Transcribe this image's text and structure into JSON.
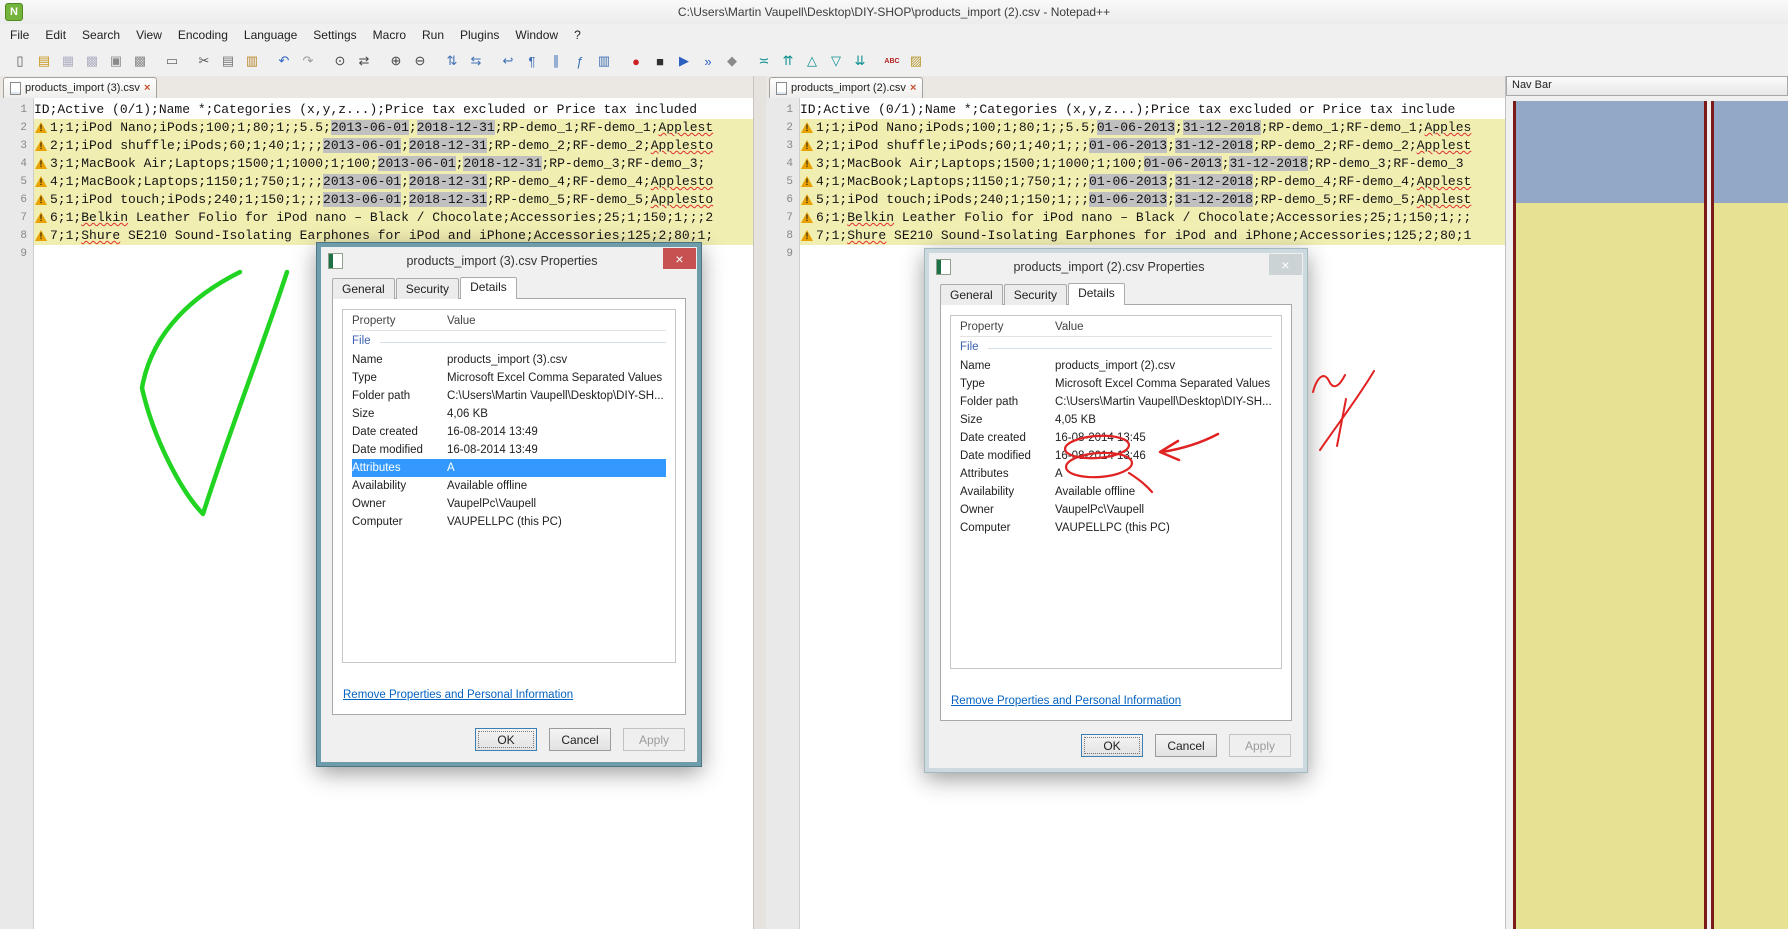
{
  "window": {
    "title": "C:\\Users\\Martin Vaupell\\Desktop\\DIY-SHOP\\products_import (2).csv - Notepad++"
  },
  "menu": {
    "items": [
      "File",
      "Edit",
      "Search",
      "View",
      "Encoding",
      "Language",
      "Settings",
      "Macro",
      "Run",
      "Plugins",
      "Window",
      "?"
    ]
  },
  "toolbar": {
    "icons": [
      {
        "name": "new-file",
        "glyph": "▯",
        "color": "#5a5a5a"
      },
      {
        "name": "open-file",
        "glyph": "▤",
        "color": "#c9971c"
      },
      {
        "name": "save-file",
        "glyph": "▦",
        "color": "#b0b0c4"
      },
      {
        "name": "save-all",
        "glyph": "▩",
        "color": "#b0b0c4"
      },
      {
        "name": "close-file",
        "glyph": "▣",
        "color": "#8a8a8a"
      },
      {
        "name": "close-all",
        "glyph": "▩",
        "color": "#8a8a8a"
      },
      {
        "name": "print",
        "glyph": "▭",
        "color": "#6a6a6a",
        "gap": true
      },
      {
        "name": "cut",
        "glyph": "✂",
        "color": "#555555",
        "gap": true
      },
      {
        "name": "copy",
        "glyph": "▤",
        "color": "#777777"
      },
      {
        "name": "paste",
        "glyph": "▥",
        "color": "#b8862c"
      },
      {
        "name": "undo",
        "glyph": "↶",
        "color": "#2f62c4",
        "gap": true
      },
      {
        "name": "redo",
        "glyph": "↷",
        "color": "#9a9a9a"
      },
      {
        "name": "find",
        "glyph": "⊙",
        "color": "#444444",
        "gap": true
      },
      {
        "name": "replace",
        "glyph": "⇄",
        "color": "#444444"
      },
      {
        "name": "zoom-in",
        "glyph": "⊕",
        "color": "#444444",
        "gap": true
      },
      {
        "name": "zoom-out",
        "glyph": "⊖",
        "color": "#444444"
      },
      {
        "name": "sync-vertical-scroll",
        "glyph": "⇅",
        "color": "#3f6fb4",
        "gap": true
      },
      {
        "name": "sync-horizontal-scroll",
        "glyph": "⇆",
        "color": "#3f6fb4"
      },
      {
        "name": "word-wrap",
        "glyph": "↩",
        "color": "#3f6fb4",
        "gap": true
      },
      {
        "name": "show-all-characters",
        "glyph": "¶",
        "color": "#3f6fb4"
      },
      {
        "name": "indent-guide",
        "glyph": "∥",
        "color": "#3f6fb4"
      },
      {
        "name": "function-list",
        "glyph": "ƒ",
        "color": "#3f6fb4"
      },
      {
        "name": "document-map",
        "glyph": "▥",
        "color": "#3f6fb4"
      },
      {
        "name": "record-macro",
        "glyph": "●",
        "color": "#cc2020",
        "gap": true
      },
      {
        "name": "stop-macro",
        "glyph": "■",
        "color": "#303030"
      },
      {
        "name": "play-macro",
        "glyph": "▶",
        "color": "#2b5fc0"
      },
      {
        "name": "run-macro-multiple",
        "glyph": "»",
        "color": "#2b5fc0"
      },
      {
        "name": "save-macro",
        "glyph": "◆",
        "color": "#8a8a8a"
      },
      {
        "name": "compare",
        "glyph": "≍",
        "color": "#0c8f8f",
        "gap": true
      },
      {
        "name": "compare-first",
        "glyph": "⇈",
        "color": "#0c8f8f"
      },
      {
        "name": "compare-prev",
        "glyph": "△",
        "color": "#0c8f8f"
      },
      {
        "name": "compare-next",
        "glyph": "▽",
        "color": "#0c8f8f"
      },
      {
        "name": "compare-last",
        "glyph": "⇊",
        "color": "#0c8f8f"
      },
      {
        "name": "spell-check",
        "glyph": "ABC",
        "color": "#b02020",
        "small": true,
        "gap": true
      },
      {
        "name": "nav-bar-toggle",
        "glyph": "▨",
        "color": "#b99a2e"
      }
    ]
  },
  "panes": {
    "left": {
      "tab": "products_import (3).csv",
      "lines": [
        {
          "n": 1,
          "changed": false,
          "seg": [
            {
              "t": "ID;Active (0/1);Name *;Categories (x,y,z...);Price tax excluded or Price tax included"
            }
          ]
        },
        {
          "n": 2,
          "changed": true,
          "seg": [
            {
              "t": "1;1;iPod Nano;iPods;100;1;80;1;;5.5;"
            },
            {
              "t": "2013-06-01",
              "s": "h"
            },
            {
              "t": ";"
            },
            {
              "t": "2018-12-31",
              "s": "h"
            },
            {
              "t": ";RP-demo_1;RF-demo_1;"
            },
            {
              "t": "Applest",
              "s": "r"
            }
          ]
        },
        {
          "n": 3,
          "changed": true,
          "seg": [
            {
              "t": "2;1;iPod shuffle;iPods;60;1;40;1;;;"
            },
            {
              "t": "2013-06-01",
              "s": "h"
            },
            {
              "t": ";"
            },
            {
              "t": "2018-12-31",
              "s": "h"
            },
            {
              "t": ";RP-demo_2;RF-demo_2;"
            },
            {
              "t": "Applesto",
              "s": "r"
            }
          ]
        },
        {
          "n": 4,
          "changed": true,
          "seg": [
            {
              "t": "3;1;MacBook Air;Laptops;1500;1;1000;1;100;"
            },
            {
              "t": "2013-06-01",
              "s": "h"
            },
            {
              "t": ";"
            },
            {
              "t": "2018-12-31",
              "s": "h"
            },
            {
              "t": ";RP-demo_3;RF-demo_3;"
            }
          ]
        },
        {
          "n": 5,
          "changed": true,
          "seg": [
            {
              "t": "4;1;MacBook;Laptops;1150;1;750;1;;;"
            },
            {
              "t": "2013-06-01",
              "s": "h"
            },
            {
              "t": ";"
            },
            {
              "t": "2018-12-31",
              "s": "h"
            },
            {
              "t": ";RP-demo_4;RF-demo_4;"
            },
            {
              "t": "Applesto",
              "s": "r"
            }
          ]
        },
        {
          "n": 6,
          "changed": true,
          "seg": [
            {
              "t": "5;1;iPod touch;iPods;240;1;150;1;;;"
            },
            {
              "t": "2013-06-01",
              "s": "h"
            },
            {
              "t": ";"
            },
            {
              "t": "2018-12-31",
              "s": "h"
            },
            {
              "t": ";RP-demo_5;RF-demo_5;"
            },
            {
              "t": "Applesto",
              "s": "r"
            }
          ]
        },
        {
          "n": 7,
          "changed": true,
          "seg": [
            {
              "t": "6;1;"
            },
            {
              "t": "Belkin",
              "s": "r"
            },
            {
              "t": " Leather Folio for iPod nano – Black / Chocolate;Accessories;25;1;150;1;;;2"
            }
          ]
        },
        {
          "n": 8,
          "changed": true,
          "seg": [
            {
              "t": "7;1;"
            },
            {
              "t": "Shure",
              "s": "r"
            },
            {
              "t": " SE210 Sound-Isolating Earphones for iPod and iPhone;Accessories;125;2;80;1;"
            }
          ]
        },
        {
          "n": 9,
          "changed": false,
          "seg": []
        }
      ]
    },
    "right": {
      "tab": "products_import (2).csv",
      "lines": [
        {
          "n": 1,
          "changed": false,
          "seg": [
            {
              "t": "ID;Active (0/1);Name *;Categories (x,y,z...);Price tax excluded or Price tax include"
            }
          ]
        },
        {
          "n": 2,
          "changed": true,
          "seg": [
            {
              "t": "1;1;iPod Nano;iPods;100;1;80;1;;5.5;"
            },
            {
              "t": "01-06-2013",
              "s": "h"
            },
            {
              "t": ";"
            },
            {
              "t": "31-12-2018",
              "s": "h"
            },
            {
              "t": ";RP-demo_1;RF-demo_1;"
            },
            {
              "t": "Apples",
              "s": "r"
            }
          ]
        },
        {
          "n": 3,
          "changed": true,
          "seg": [
            {
              "t": "2;1;iPod shuffle;iPods;60;1;40;1;;;"
            },
            {
              "t": "01-06-2013",
              "s": "h"
            },
            {
              "t": ";"
            },
            {
              "t": "31-12-2018",
              "s": "h"
            },
            {
              "t": ";RP-demo_2;RF-demo_2;"
            },
            {
              "t": "Applest",
              "s": "r"
            }
          ]
        },
        {
          "n": 4,
          "changed": true,
          "seg": [
            {
              "t": "3;1;MacBook Air;Laptops;1500;1;1000;1;100;"
            },
            {
              "t": "01-06-2013",
              "s": "h"
            },
            {
              "t": ";"
            },
            {
              "t": "31-12-2018",
              "s": "h"
            },
            {
              "t": ";RP-demo_3;RF-demo_3"
            }
          ]
        },
        {
          "n": 5,
          "changed": true,
          "seg": [
            {
              "t": "4;1;MacBook;Laptops;1150;1;750;1;;;"
            },
            {
              "t": "01-06-2013",
              "s": "h"
            },
            {
              "t": ";"
            },
            {
              "t": "31-12-2018",
              "s": "h"
            },
            {
              "t": ";RP-demo_4;RF-demo_4;"
            },
            {
              "t": "Applest",
              "s": "r"
            }
          ]
        },
        {
          "n": 6,
          "changed": true,
          "seg": [
            {
              "t": "5;1;iPod touch;iPods;240;1;150;1;;;"
            },
            {
              "t": "01-06-2013",
              "s": "h"
            },
            {
              "t": ";"
            },
            {
              "t": "31-12-2018",
              "s": "h"
            },
            {
              "t": ";RP-demo_5;RF-demo_5;"
            },
            {
              "t": "Applest",
              "s": "r"
            }
          ]
        },
        {
          "n": 7,
          "changed": true,
          "seg": [
            {
              "t": "6;1;"
            },
            {
              "t": "Belkin",
              "s": "r"
            },
            {
              "t": " Leather Folio for iPod nano – Black / Chocolate;Accessories;25;1;150;1;;;"
            }
          ]
        },
        {
          "n": 8,
          "changed": true,
          "seg": [
            {
              "t": "7;1;"
            },
            {
              "t": "Shure",
              "s": "r"
            },
            {
              "t": " SE210 Sound-Isolating Earphones for iPod and iPhone;Accessories;125;2;80;1"
            }
          ]
        },
        {
          "n": 9,
          "changed": false,
          "seg": []
        }
      ]
    }
  },
  "dialogs": {
    "tabs": [
      "General",
      "Security",
      "Details"
    ],
    "buttons": {
      "ok": "OK",
      "cancel": "Cancel",
      "apply": "Apply"
    },
    "columns": {
      "property": "Property",
      "value": "Value"
    },
    "group": "File",
    "link": "Remove Properties and Personal Information",
    "left": {
      "title": "products_import (3).csv Properties",
      "rows": [
        {
          "label": "Name",
          "value": "products_import (3).csv"
        },
        {
          "label": "Type",
          "value": "Microsoft Excel Comma Separated Values ..."
        },
        {
          "label": "Folder path",
          "value": "C:\\Users\\Martin Vaupell\\Desktop\\DIY-SH..."
        },
        {
          "label": "Size",
          "value": "4,06 KB"
        },
        {
          "label": "Date created",
          "value": "16-08-2014 13:49"
        },
        {
          "label": "Date modified",
          "value": "16-08-2014 13:49"
        },
        {
          "label": "Attributes",
          "value": "A",
          "sel": true
        },
        {
          "label": "Availability",
          "value": "Available offline"
        },
        {
          "label": "Owner",
          "value": "VaupelPc\\Vaupell"
        },
        {
          "label": "Computer",
          "value": "VAUPELLPC (this PC)"
        }
      ]
    },
    "right": {
      "title": "products_import (2).csv Properties",
      "rows": [
        {
          "label": "Name",
          "value": "products_import (2).csv"
        },
        {
          "label": "Type",
          "value": "Microsoft Excel Comma Separated Values ..."
        },
        {
          "label": "Folder path",
          "value": "C:\\Users\\Martin Vaupell\\Desktop\\DIY-SH..."
        },
        {
          "label": "Size",
          "value": "4,05 KB"
        },
        {
          "label": "Date created",
          "value": "16-08-2014 13:45"
        },
        {
          "label": "Date modified",
          "value": "16-08-2014 13:46"
        },
        {
          "label": "Attributes",
          "value": "A"
        },
        {
          "label": "Availability",
          "value": "Available offline"
        },
        {
          "label": "Owner",
          "value": "VaupelPc\\Vaupell"
        },
        {
          "label": "Computer",
          "value": "VAUPELLPC (this PC)"
        }
      ]
    }
  },
  "navbar": {
    "title": "Nav Bar"
  },
  "colors": {
    "changed_line_bg": "#f1eeb2",
    "diff_word_bg": "#c0c0c0",
    "selection_blue": "#3399ff",
    "nav_moved_blue": "#93a8c6",
    "nav_changed_yellow": "#e6e291",
    "nav_border_maroon": "#7c1a1a",
    "annotation_green": "#21d421",
    "annotation_red": "#e02222",
    "link_blue": "#0563c1",
    "warning_orange": "#e8a200",
    "dialog_active_border": "#6d9cab",
    "dialog_inactive_border": "#ccd9de"
  }
}
